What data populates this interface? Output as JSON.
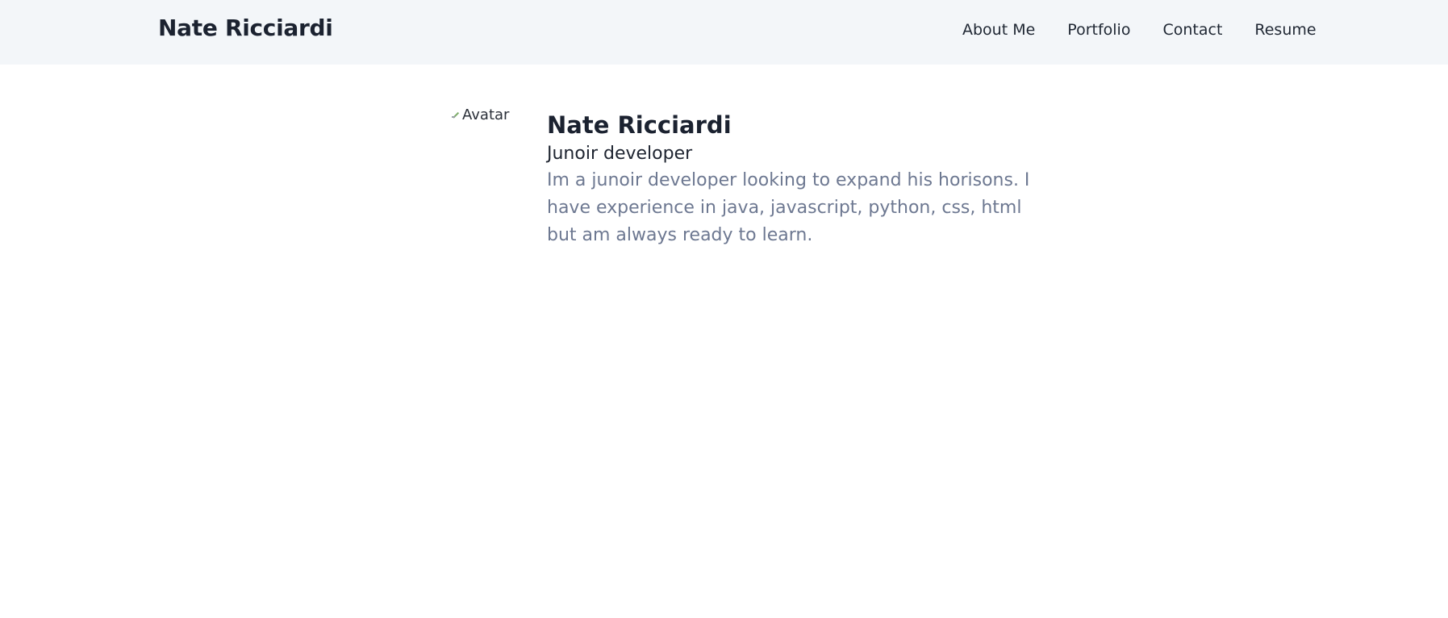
{
  "header": {
    "brand": "Nate Ricciardi",
    "nav": [
      {
        "label": "About Me"
      },
      {
        "label": "Portfolio"
      },
      {
        "label": "Contact"
      },
      {
        "label": "Resume"
      }
    ]
  },
  "profile": {
    "avatar_alt": "Avatar",
    "name": "Nate Ricciardi",
    "role": "Junoir developer",
    "bio": "Im a junoir developer looking to expand his horisons. I have experience in java, javascript, python, css, html but am always ready to learn."
  }
}
